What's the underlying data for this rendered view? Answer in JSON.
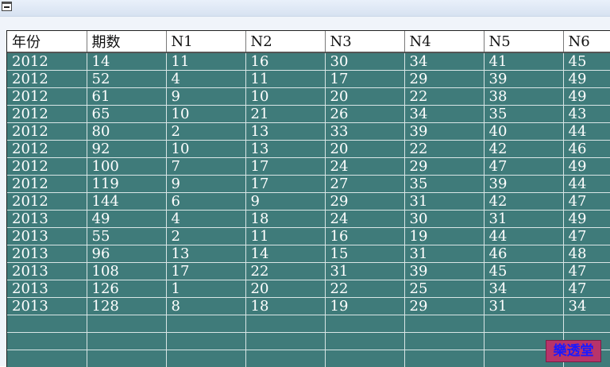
{
  "window": {
    "system_menu_icon": "window-system-menu-icon"
  },
  "table": {
    "headers": [
      "年份",
      "期数",
      "N1",
      "N2",
      "N3",
      "N4",
      "N5",
      "N6"
    ],
    "rows": [
      [
        "2012",
        "14",
        "11",
        "16",
        "30",
        "34",
        "41",
        "45"
      ],
      [
        "2012",
        "52",
        "4",
        "11",
        "17",
        "29",
        "39",
        "49"
      ],
      [
        "2012",
        "61",
        "9",
        "10",
        "20",
        "22",
        "38",
        "49"
      ],
      [
        "2012",
        "65",
        "10",
        "21",
        "26",
        "34",
        "35",
        "43"
      ],
      [
        "2012",
        "80",
        "2",
        "13",
        "33",
        "39",
        "40",
        "44"
      ],
      [
        "2012",
        "92",
        "10",
        "13",
        "20",
        "22",
        "42",
        "46"
      ],
      [
        "2012",
        "100",
        "7",
        "17",
        "24",
        "29",
        "47",
        "49"
      ],
      [
        "2012",
        "119",
        "9",
        "17",
        "27",
        "35",
        "39",
        "44"
      ],
      [
        "2012",
        "144",
        "6",
        "9",
        "29",
        "31",
        "42",
        "47"
      ],
      [
        "2013",
        "49",
        "4",
        "18",
        "24",
        "30",
        "31",
        "49"
      ],
      [
        "2013",
        "55",
        "2",
        "11",
        "16",
        "19",
        "44",
        "47"
      ],
      [
        "2013",
        "96",
        "13",
        "14",
        "15",
        "31",
        "46",
        "48"
      ],
      [
        "2013",
        "108",
        "17",
        "22",
        "31",
        "39",
        "45",
        "47"
      ],
      [
        "2013",
        "126",
        "1",
        "20",
        "22",
        "25",
        "34",
        "47"
      ],
      [
        "2013",
        "128",
        "8",
        "18",
        "19",
        "29",
        "31",
        "34"
      ],
      [
        "",
        "",
        "",
        "",
        "",
        "",
        "",
        ""
      ],
      [
        "",
        "",
        "",
        "",
        "",
        "",
        "",
        ""
      ],
      [
        "",
        "",
        "",
        "",
        "",
        "",
        "",
        ""
      ]
    ]
  },
  "watermark": {
    "text": "樂透堂"
  },
  "colors": {
    "grid_background": "#3f7b7a",
    "header_background": "#ffffff",
    "watermark_background": "#b8336a",
    "watermark_text": "#1a1aff"
  }
}
